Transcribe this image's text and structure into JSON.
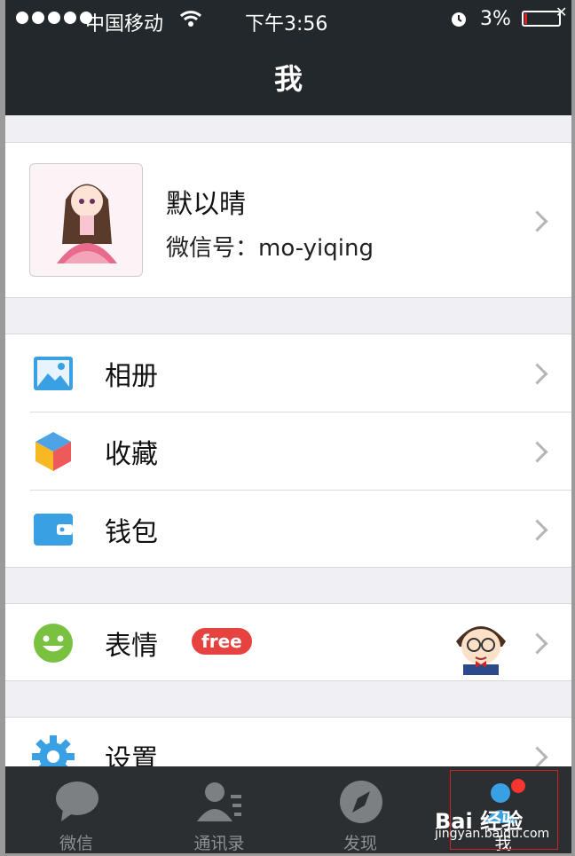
{
  "status_bar": {
    "carrier": "中国移动",
    "time": "下午3:56",
    "battery": "3%",
    "battery_x": "✕"
  },
  "nav": {
    "title": "我"
  },
  "profile": {
    "name": "默以晴",
    "wechat_id": "微信号：mo-yiqing"
  },
  "menu": {
    "album": "相册",
    "favorites": "收藏",
    "wallet": "钱包",
    "stickers": "表情",
    "stickers_badge": "free",
    "settings": "设置"
  },
  "tabs": [
    {
      "label": "微信"
    },
    {
      "label": "通讯录"
    },
    {
      "label": "发现"
    },
    {
      "label": "我"
    }
  ],
  "watermark": {
    "logo": "Bai 经验",
    "url": "jingyan.baidu.com"
  },
  "colors": {
    "accent_red": "#e64340",
    "nav_bg": "#22282b",
    "tab_bg": "#2b2f31"
  }
}
